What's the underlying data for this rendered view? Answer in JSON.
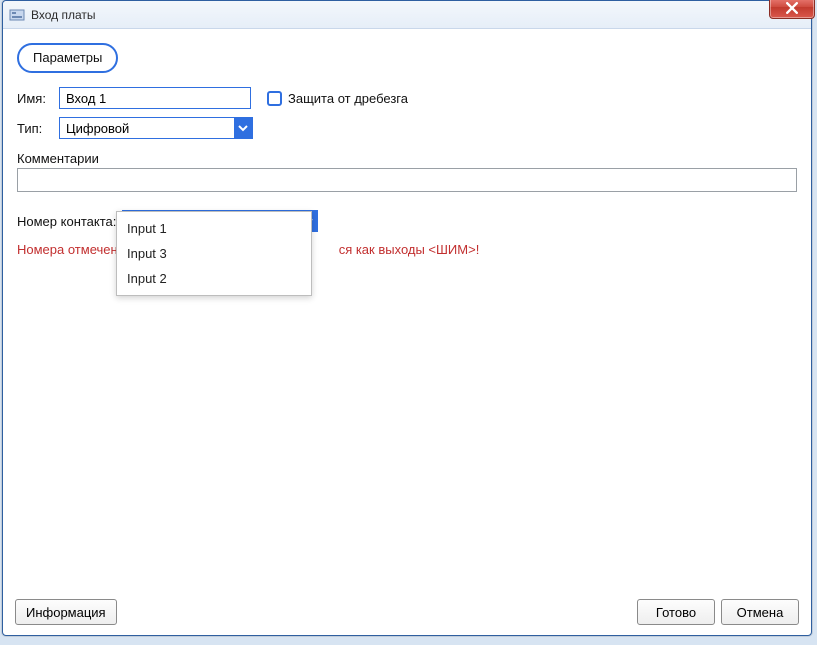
{
  "window": {
    "title": "Вход платы"
  },
  "tabs": {
    "parameters": "Параметры"
  },
  "form": {
    "name_label": "Имя:",
    "name_value": "Вход 1",
    "type_label": "Тип:",
    "type_value": "Цифровой",
    "debounce_label": "Защита от дребезга",
    "comments_label": "Комментарии",
    "comments_value": "",
    "contact_label": "Номер контакта:",
    "contact_value": "",
    "contact_options": [
      "Input 1",
      "Input 3",
      "Input 2"
    ],
    "warning_prefix": "Номера отмечен",
    "warning_suffix": "ся как выходы <ШИМ>!"
  },
  "footer": {
    "info": "Информация",
    "ok": "Готово",
    "cancel": "Отмена"
  }
}
